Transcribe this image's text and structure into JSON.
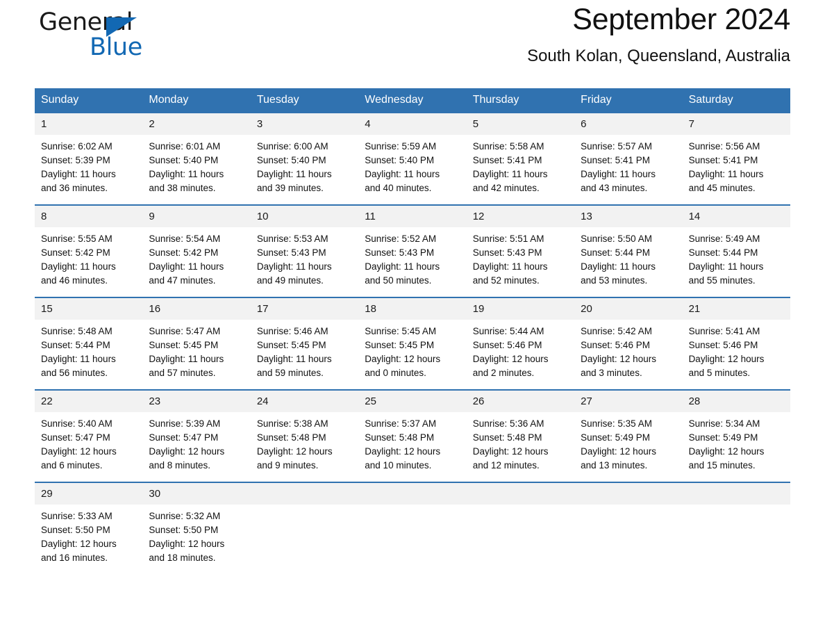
{
  "brand": {
    "name_part1": "General",
    "name_part2": "Blue",
    "accent_color": "#1268b3"
  },
  "header": {
    "title": "September 2024",
    "location": "South Kolan, Queensland, Australia"
  },
  "theme": {
    "header_band": "#3072b0",
    "daynum_band": "#f2f2f2",
    "text": "#111111"
  },
  "weekdays": [
    "Sunday",
    "Monday",
    "Tuesday",
    "Wednesday",
    "Thursday",
    "Friday",
    "Saturday"
  ],
  "weeks": [
    {
      "days": [
        {
          "num": "1",
          "sunrise": "Sunrise: 6:02 AM",
          "sunset": "Sunset: 5:39 PM",
          "daylight1": "Daylight: 11 hours",
          "daylight2": "and 36 minutes."
        },
        {
          "num": "2",
          "sunrise": "Sunrise: 6:01 AM",
          "sunset": "Sunset: 5:40 PM",
          "daylight1": "Daylight: 11 hours",
          "daylight2": "and 38 minutes."
        },
        {
          "num": "3",
          "sunrise": "Sunrise: 6:00 AM",
          "sunset": "Sunset: 5:40 PM",
          "daylight1": "Daylight: 11 hours",
          "daylight2": "and 39 minutes."
        },
        {
          "num": "4",
          "sunrise": "Sunrise: 5:59 AM",
          "sunset": "Sunset: 5:40 PM",
          "daylight1": "Daylight: 11 hours",
          "daylight2": "and 40 minutes."
        },
        {
          "num": "5",
          "sunrise": "Sunrise: 5:58 AM",
          "sunset": "Sunset: 5:41 PM",
          "daylight1": "Daylight: 11 hours",
          "daylight2": "and 42 minutes."
        },
        {
          "num": "6",
          "sunrise": "Sunrise: 5:57 AM",
          "sunset": "Sunset: 5:41 PM",
          "daylight1": "Daylight: 11 hours",
          "daylight2": "and 43 minutes."
        },
        {
          "num": "7",
          "sunrise": "Sunrise: 5:56 AM",
          "sunset": "Sunset: 5:41 PM",
          "daylight1": "Daylight: 11 hours",
          "daylight2": "and 45 minutes."
        }
      ]
    },
    {
      "days": [
        {
          "num": "8",
          "sunrise": "Sunrise: 5:55 AM",
          "sunset": "Sunset: 5:42 PM",
          "daylight1": "Daylight: 11 hours",
          "daylight2": "and 46 minutes."
        },
        {
          "num": "9",
          "sunrise": "Sunrise: 5:54 AM",
          "sunset": "Sunset: 5:42 PM",
          "daylight1": "Daylight: 11 hours",
          "daylight2": "and 47 minutes."
        },
        {
          "num": "10",
          "sunrise": "Sunrise: 5:53 AM",
          "sunset": "Sunset: 5:43 PM",
          "daylight1": "Daylight: 11 hours",
          "daylight2": "and 49 minutes."
        },
        {
          "num": "11",
          "sunrise": "Sunrise: 5:52 AM",
          "sunset": "Sunset: 5:43 PM",
          "daylight1": "Daylight: 11 hours",
          "daylight2": "and 50 minutes."
        },
        {
          "num": "12",
          "sunrise": "Sunrise: 5:51 AM",
          "sunset": "Sunset: 5:43 PM",
          "daylight1": "Daylight: 11 hours",
          "daylight2": "and 52 minutes."
        },
        {
          "num": "13",
          "sunrise": "Sunrise: 5:50 AM",
          "sunset": "Sunset: 5:44 PM",
          "daylight1": "Daylight: 11 hours",
          "daylight2": "and 53 minutes."
        },
        {
          "num": "14",
          "sunrise": "Sunrise: 5:49 AM",
          "sunset": "Sunset: 5:44 PM",
          "daylight1": "Daylight: 11 hours",
          "daylight2": "and 55 minutes."
        }
      ]
    },
    {
      "days": [
        {
          "num": "15",
          "sunrise": "Sunrise: 5:48 AM",
          "sunset": "Sunset: 5:44 PM",
          "daylight1": "Daylight: 11 hours",
          "daylight2": "and 56 minutes."
        },
        {
          "num": "16",
          "sunrise": "Sunrise: 5:47 AM",
          "sunset": "Sunset: 5:45 PM",
          "daylight1": "Daylight: 11 hours",
          "daylight2": "and 57 minutes."
        },
        {
          "num": "17",
          "sunrise": "Sunrise: 5:46 AM",
          "sunset": "Sunset: 5:45 PM",
          "daylight1": "Daylight: 11 hours",
          "daylight2": "and 59 minutes."
        },
        {
          "num": "18",
          "sunrise": "Sunrise: 5:45 AM",
          "sunset": "Sunset: 5:45 PM",
          "daylight1": "Daylight: 12 hours",
          "daylight2": "and 0 minutes."
        },
        {
          "num": "19",
          "sunrise": "Sunrise: 5:44 AM",
          "sunset": "Sunset: 5:46 PM",
          "daylight1": "Daylight: 12 hours",
          "daylight2": "and 2 minutes."
        },
        {
          "num": "20",
          "sunrise": "Sunrise: 5:42 AM",
          "sunset": "Sunset: 5:46 PM",
          "daylight1": "Daylight: 12 hours",
          "daylight2": "and 3 minutes."
        },
        {
          "num": "21",
          "sunrise": "Sunrise: 5:41 AM",
          "sunset": "Sunset: 5:46 PM",
          "daylight1": "Daylight: 12 hours",
          "daylight2": "and 5 minutes."
        }
      ]
    },
    {
      "days": [
        {
          "num": "22",
          "sunrise": "Sunrise: 5:40 AM",
          "sunset": "Sunset: 5:47 PM",
          "daylight1": "Daylight: 12 hours",
          "daylight2": "and 6 minutes."
        },
        {
          "num": "23",
          "sunrise": "Sunrise: 5:39 AM",
          "sunset": "Sunset: 5:47 PM",
          "daylight1": "Daylight: 12 hours",
          "daylight2": "and 8 minutes."
        },
        {
          "num": "24",
          "sunrise": "Sunrise: 5:38 AM",
          "sunset": "Sunset: 5:48 PM",
          "daylight1": "Daylight: 12 hours",
          "daylight2": "and 9 minutes."
        },
        {
          "num": "25",
          "sunrise": "Sunrise: 5:37 AM",
          "sunset": "Sunset: 5:48 PM",
          "daylight1": "Daylight: 12 hours",
          "daylight2": "and 10 minutes."
        },
        {
          "num": "26",
          "sunrise": "Sunrise: 5:36 AM",
          "sunset": "Sunset: 5:48 PM",
          "daylight1": "Daylight: 12 hours",
          "daylight2": "and 12 minutes."
        },
        {
          "num": "27",
          "sunrise": "Sunrise: 5:35 AM",
          "sunset": "Sunset: 5:49 PM",
          "daylight1": "Daylight: 12 hours",
          "daylight2": "and 13 minutes."
        },
        {
          "num": "28",
          "sunrise": "Sunrise: 5:34 AM",
          "sunset": "Sunset: 5:49 PM",
          "daylight1": "Daylight: 12 hours",
          "daylight2": "and 15 minutes."
        }
      ]
    },
    {
      "days": [
        {
          "num": "29",
          "sunrise": "Sunrise: 5:33 AM",
          "sunset": "Sunset: 5:50 PM",
          "daylight1": "Daylight: 12 hours",
          "daylight2": "and 16 minutes."
        },
        {
          "num": "30",
          "sunrise": "Sunrise: 5:32 AM",
          "sunset": "Sunset: 5:50 PM",
          "daylight1": "Daylight: 12 hours",
          "daylight2": "and 18 minutes."
        },
        {
          "num": "",
          "sunrise": "",
          "sunset": "",
          "daylight1": "",
          "daylight2": ""
        },
        {
          "num": "",
          "sunrise": "",
          "sunset": "",
          "daylight1": "",
          "daylight2": ""
        },
        {
          "num": "",
          "sunrise": "",
          "sunset": "",
          "daylight1": "",
          "daylight2": ""
        },
        {
          "num": "",
          "sunrise": "",
          "sunset": "",
          "daylight1": "",
          "daylight2": ""
        },
        {
          "num": "",
          "sunrise": "",
          "sunset": "",
          "daylight1": "",
          "daylight2": ""
        }
      ]
    }
  ]
}
